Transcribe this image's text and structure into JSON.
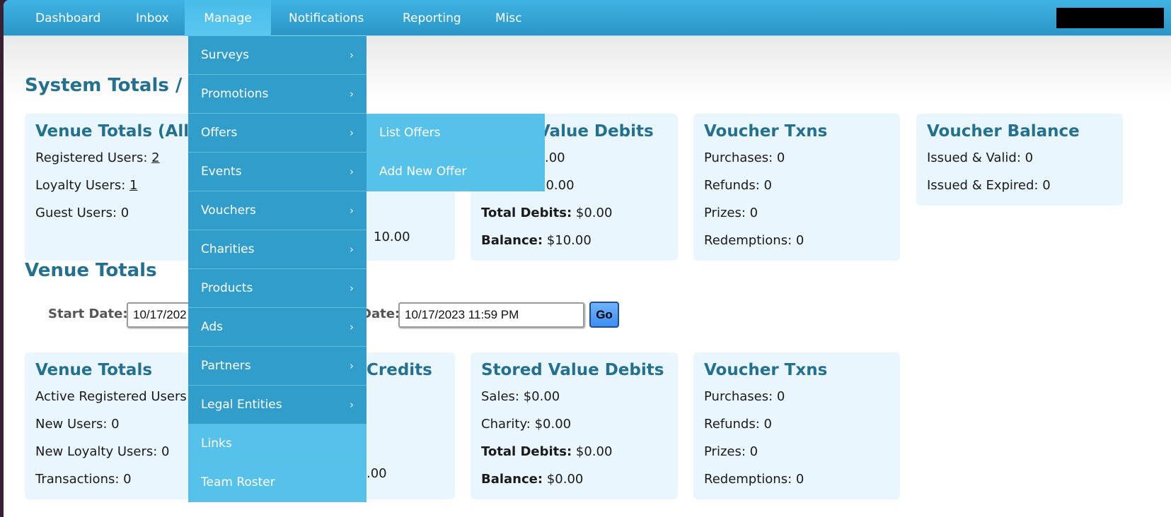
{
  "nav": {
    "items": [
      "Dashboard",
      "Inbox",
      "Manage",
      "Notifications",
      "Reporting",
      "Misc"
    ]
  },
  "system": {
    "title": "System Totals / Pr",
    "venue_all": {
      "title": "Venue Totals (All)",
      "registered_label": "Registered Users:",
      "registered_value": "2",
      "loyalty_label": "Loyalty Users:",
      "loyalty_value": "1",
      "guest": "Guest Users: 0"
    },
    "credits_partial": "10.00",
    "debits": {
      "title": "Value Debits",
      "row1": ".00",
      "row2": "$0.00",
      "total_label": "Total Debits:",
      "total_value": "$0.00",
      "balance_label": "Balance:",
      "balance_value": "$10.00"
    },
    "voucher_txns": {
      "title": "Voucher Txns",
      "purchases": "Purchases: 0",
      "refunds": "Refunds: 0",
      "prizes": "Prizes: 0",
      "redemptions": "Redemptions: 0"
    },
    "voucher_balance": {
      "title": "Voucher Balance",
      "valid": "Issued & Valid: 0",
      "expired": "Issued & Expired: 0"
    }
  },
  "venue": {
    "title": "Venue Totals",
    "start_label": "Start Date:",
    "start_value": "10/17/202",
    "end_label": "Date:",
    "end_value": "10/17/2023 11:59 PM",
    "go_label": "Go",
    "totals": {
      "title": "Venue Totals",
      "active": "Active Registered Users",
      "new_users": "New Users: 0",
      "new_loyalty": "New Loyalty Users: 0",
      "transactions": "Transactions: 0"
    },
    "credits": {
      "title": "Credits",
      "last": ".00"
    },
    "debits": {
      "title": "Stored Value Debits",
      "sales": "Sales: $0.00",
      "charity": "Charity: $0.00",
      "total_label": "Total Debits:",
      "total_value": "$0.00",
      "balance_label": "Balance:",
      "balance_value": "$0.00"
    },
    "voucher_txns": {
      "title": "Voucher Txns",
      "purchases": "Purchases: 0",
      "refunds": "Refunds: 0",
      "prizes": "Prizes: 0",
      "redemptions": "Redemptions: 0"
    }
  },
  "manage_menu": {
    "items": [
      "Surveys",
      "Promotions",
      "Offers",
      "Events",
      "Vouchers",
      "Charities",
      "Products",
      "Ads",
      "Partners",
      "Legal Entities",
      "Links",
      "Team Roster"
    ],
    "chevron": "›"
  },
  "offers_submenu": {
    "items": [
      "List Offers",
      "Add New Offer"
    ]
  }
}
